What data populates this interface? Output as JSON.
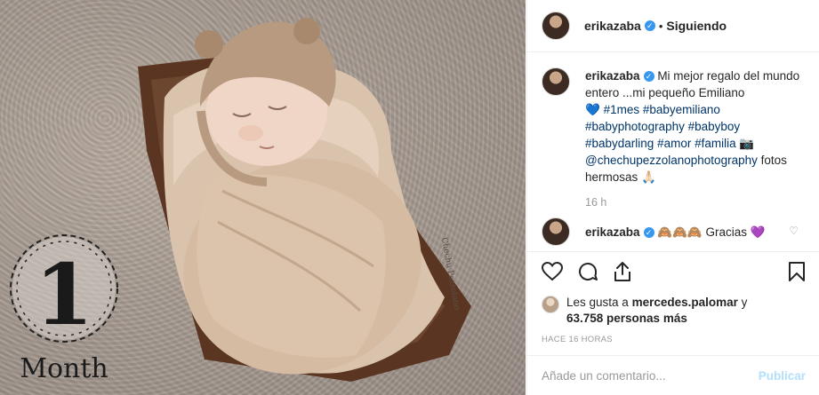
{
  "photo": {
    "milestone_number": "1",
    "milestone_word": "Month",
    "watermark": "Chechu Pezzolano"
  },
  "header": {
    "username": "erikazaba",
    "separator": "•",
    "follow_status": "Siguiendo"
  },
  "caption": {
    "username": "erikazaba",
    "text_start": "Mi mejor regalo del mundo entero ...mi pequeño Emiliano",
    "heart": "💙",
    "tags_line1": "#1mes #babyemiliano",
    "tags_line2": "#babyphotography #babyboy",
    "tags_line3": "#babydarling #amor #familia",
    "camera": "📷",
    "mention": "@chechupezzolanophotography",
    "text_end": "fotos hermosas 🙏🏻",
    "time": "16 h"
  },
  "reply": {
    "username": "erikazaba",
    "emojis": "🙈🙈🙈",
    "text": "Gracias",
    "heart": "💜"
  },
  "likes": {
    "prefix": "Les gusta a",
    "user": "mercedes.palomar",
    "connector": "y",
    "count": "63.758 personas más"
  },
  "timestamp": "HACE 16 HORAS",
  "comment_input": {
    "placeholder": "Añade un comentario...",
    "publish": "Publicar"
  }
}
